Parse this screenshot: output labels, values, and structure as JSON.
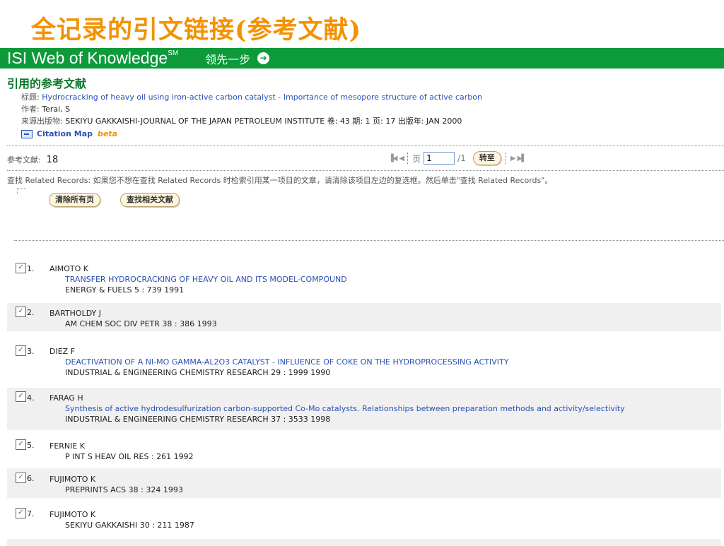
{
  "slide_title": "全记录的引文链接(参考文献)",
  "banner": {
    "brand": "ISI Web of Knowledge",
    "brand_mark": "SM",
    "slogan": "领先一步",
    "accent": "#0d9a3a"
  },
  "section_heading": "引用的参考文献",
  "record": {
    "title_label": "标题:",
    "title": "Hydrocracking of heavy oil using iron-active carbon catalyst - Importance of mesopore structure of active carbon",
    "author_label": "作者:",
    "author": "Terai, S",
    "source_label": "来源出版物:",
    "source": "SEKIYU GAKKAISHI-JOURNAL OF THE JAPAN PETROLEUM INSTITUTE 卷: 43 期: 1 页: 17 出版年: JAN 2000",
    "citation_map": "Citation Map",
    "beta": "beta"
  },
  "refbar": {
    "count_label": "参考文献:",
    "count": "18",
    "page_label": "页",
    "page_value": "1",
    "page_total": "/1",
    "go_label": "转至"
  },
  "instructions": "查找 Related Records: 如果您不想在查找 Related Records 时检索引用某一项目的文章，请清除该项目左边的复选框。然后单击\"查找 Related Records\"。",
  "buttons": {
    "clear_all": "清除所有页",
    "find_related": "查找相关文献"
  },
  "references": [
    {
      "num": "1.",
      "author": "AIMOTO K",
      "title": "TRANSFER HYDROCRACKING OF HEAVY OIL AND ITS MODEL-COMPOUND",
      "source": "ENERGY & FUELS 5 : 739 1991",
      "checked": true
    },
    {
      "num": "2.",
      "author": "BARTHOLDY J",
      "title": "",
      "source": "AM CHEM SOC DIV PETR 38 : 386 1993",
      "checked": true
    },
    {
      "num": "3.",
      "author": "DIEZ F",
      "title": "DEACTIVATION OF A NI-MO GAMMA-AL2O3 CATALYST - INFLUENCE OF COKE ON THE HYDROPROCESSING ACTIVITY",
      "source": "INDUSTRIAL & ENGINEERING CHEMISTRY RESEARCH 29 : 1999 1990",
      "checked": true
    },
    {
      "num": "4.",
      "author": "FARAG H",
      "title": "Synthesis of active hydrodesulfurization carbon-supported Co-Mo catalysts. Relationships between preparation methods and activity/selectivity",
      "source": "INDUSTRIAL & ENGINEERING CHEMISTRY RESEARCH 37 : 3533 1998",
      "checked": true
    },
    {
      "num": "5.",
      "author": "FERNIE K",
      "title": "",
      "source": "P INT S HEAV OIL RES : 261 1992",
      "checked": true
    },
    {
      "num": "6.",
      "author": "FUJIMOTO K",
      "title": "",
      "source": "PREPRINTS ACS 38 : 324 1993",
      "checked": true
    },
    {
      "num": "7.",
      "author": "FUJIMOTO K",
      "title": "",
      "source": "SEKIYU GAKKAISHI 30 : 211 1987",
      "checked": true
    }
  ]
}
